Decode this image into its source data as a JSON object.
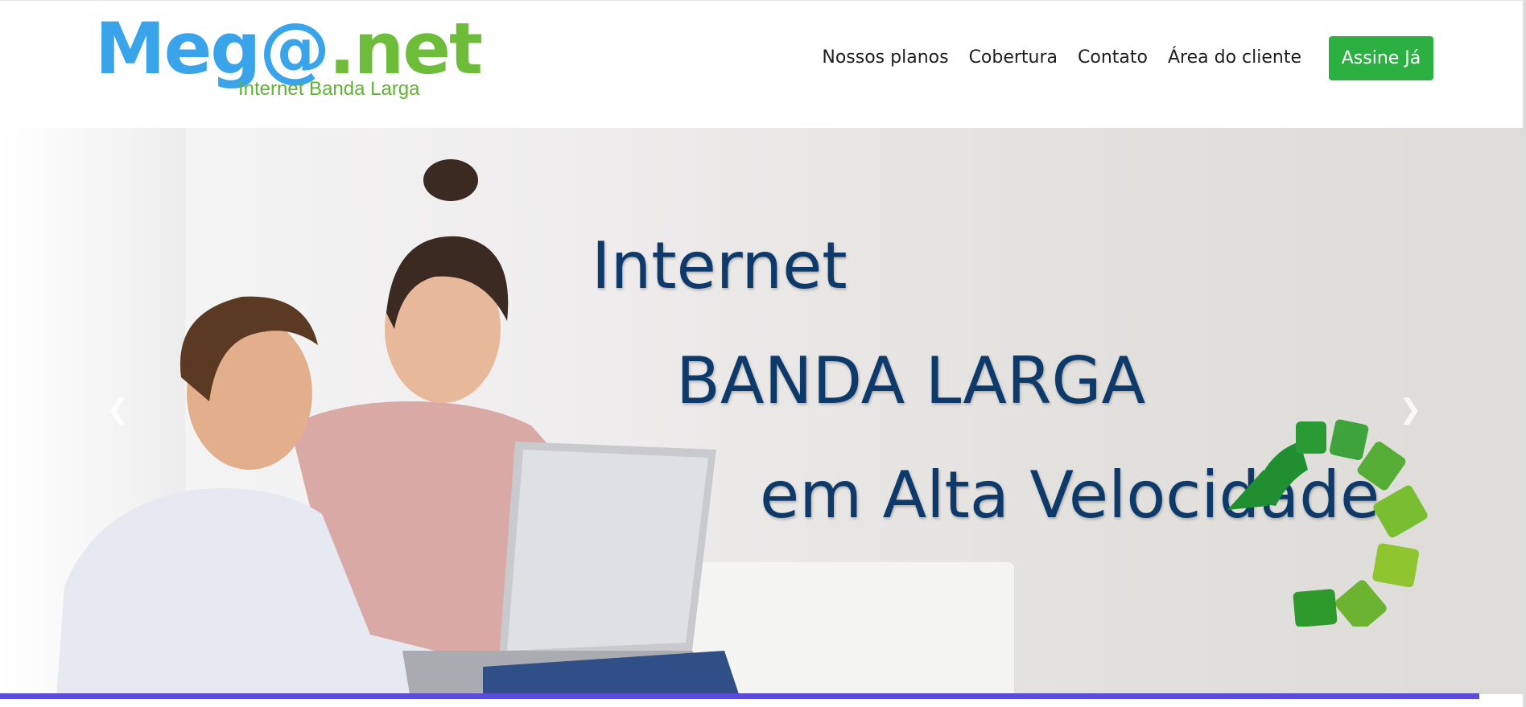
{
  "logo": {
    "text_blue": "Meg@",
    "text_green": ".net",
    "tagline": "Internet Banda Larga"
  },
  "nav": {
    "items": [
      {
        "label": "Nossos planos"
      },
      {
        "label": "Cobertura"
      },
      {
        "label": "Contato"
      },
      {
        "label": "Área do cliente"
      }
    ],
    "cta_label": "Assine Já"
  },
  "hero": {
    "line1": "Internet",
    "line2": "BANDA LARGA",
    "line3": "em Alta Velocidade",
    "prev_icon": "chevron-left-icon",
    "next_icon": "chevron-right-icon",
    "graphic_icon": "speed-arrow-icon"
  },
  "colors": {
    "brand_blue": "#3aa4ea",
    "brand_green": "#6dbd3a",
    "cta": "#2db042",
    "headline": "#0e3a6b",
    "accent_bar": "#5b4bd8"
  }
}
